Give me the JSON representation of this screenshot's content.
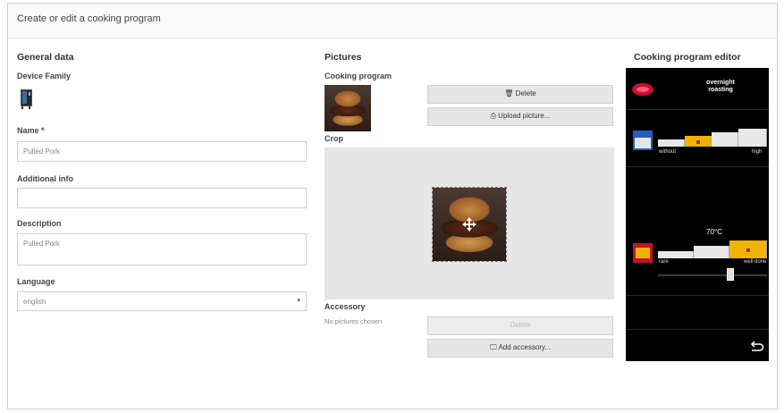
{
  "title": "Create or edit a cooking program",
  "general": {
    "heading": "General data",
    "device_family_label": "Device Family",
    "name_label": "Name *",
    "name_value": "Pulled Pork",
    "additional_info_label": "Additional info",
    "additional_info_value": "",
    "description_label": "Description",
    "description_value": "Pulled Pork",
    "language_label": "Language",
    "language_value": "english"
  },
  "pictures": {
    "heading": "Pictures",
    "cooking_program_label": "Cooking program",
    "delete_label": "🗑 Delete",
    "upload_label": "⎙ Upload picture...",
    "crop_label": "Crop",
    "accessory_label": "Accessory",
    "no_pictures_text": "No pictures chosen",
    "accessory_delete_label": "Delete",
    "add_accessory_label": "🖵 Add accessory..."
  },
  "editor": {
    "heading": "Cooking program editor",
    "program_title": "overnight\nroasting",
    "browning_min": "without",
    "browning_max": "high",
    "browning_level": 0.25,
    "temperature": "70°C",
    "doneness_min": "rare",
    "doneness_max": "well done",
    "doneness_level": 0.83,
    "slider_level": 0.58
  },
  "colors": {
    "accent": "#f0b400",
    "editor_bg": "#000000",
    "button_bg": "#e6e6e6"
  }
}
